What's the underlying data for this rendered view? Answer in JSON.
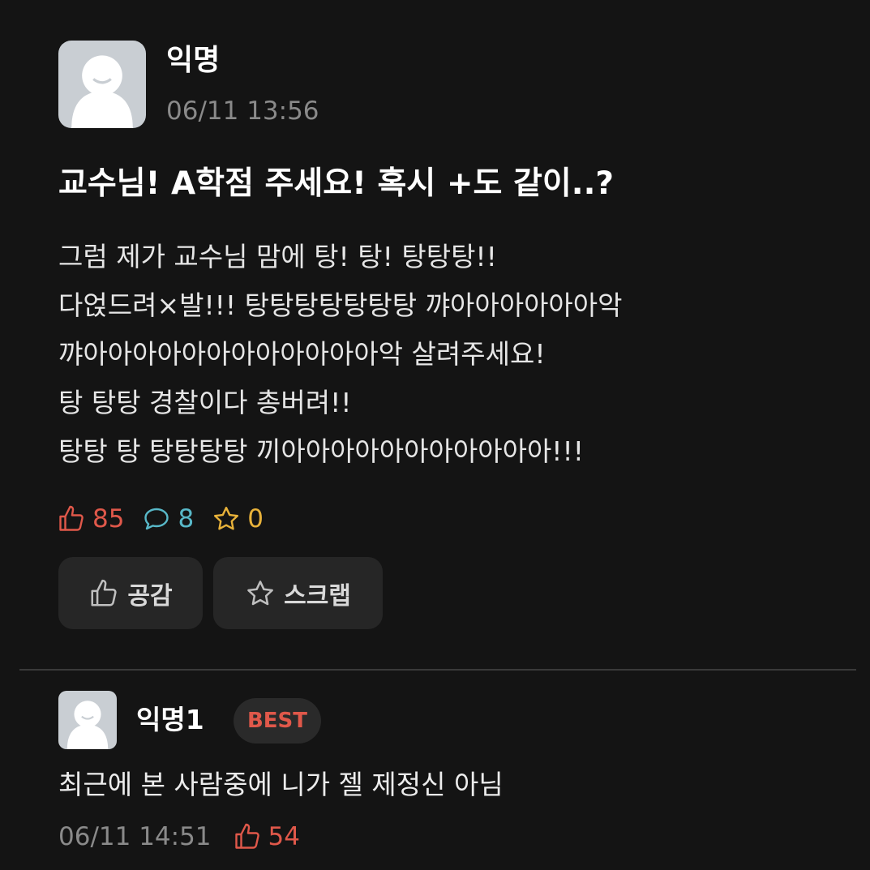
{
  "post": {
    "author": "익명",
    "time": "06/11 13:56",
    "title": "교수님! A학점 주세요! 혹시 +도 같이..?",
    "body_lines": [
      "그럼 제가 교수님 맘에 탕! 탕! 탕탕탕!!",
      "다얹드려×발!!! 탕탕탕탕탕탕탕 꺄아아아아아아악",
      "꺄아아아아아아아아아아아아악 살려주세요!",
      "탕 탕탕 경찰이다 총버려!!",
      "탕탕 탕 탕탕탕탕 끼아아아아아아아아아아아!!!"
    ],
    "stats": {
      "likes": "85",
      "comments": "8",
      "scraps": "0"
    },
    "like_icon": "thumbs-up-icon",
    "comment_icon": "speech-bubble-icon",
    "scrap_icon": "star-icon"
  },
  "actions": {
    "like_label": "공감",
    "scrap_label": "스크랩"
  },
  "comments": [
    {
      "author": "익명1",
      "badge": "BEST",
      "text": "최근에 본 사람중에 니가 젤 제정신 아님",
      "time": "06/11 14:51",
      "likes": "54"
    }
  ],
  "colors": {
    "background": "#141414",
    "like": "#e0584a",
    "comment": "#58b8c8",
    "scrap": "#e8b23a",
    "button_bg": "#262626",
    "muted": "#8a8a8a"
  }
}
